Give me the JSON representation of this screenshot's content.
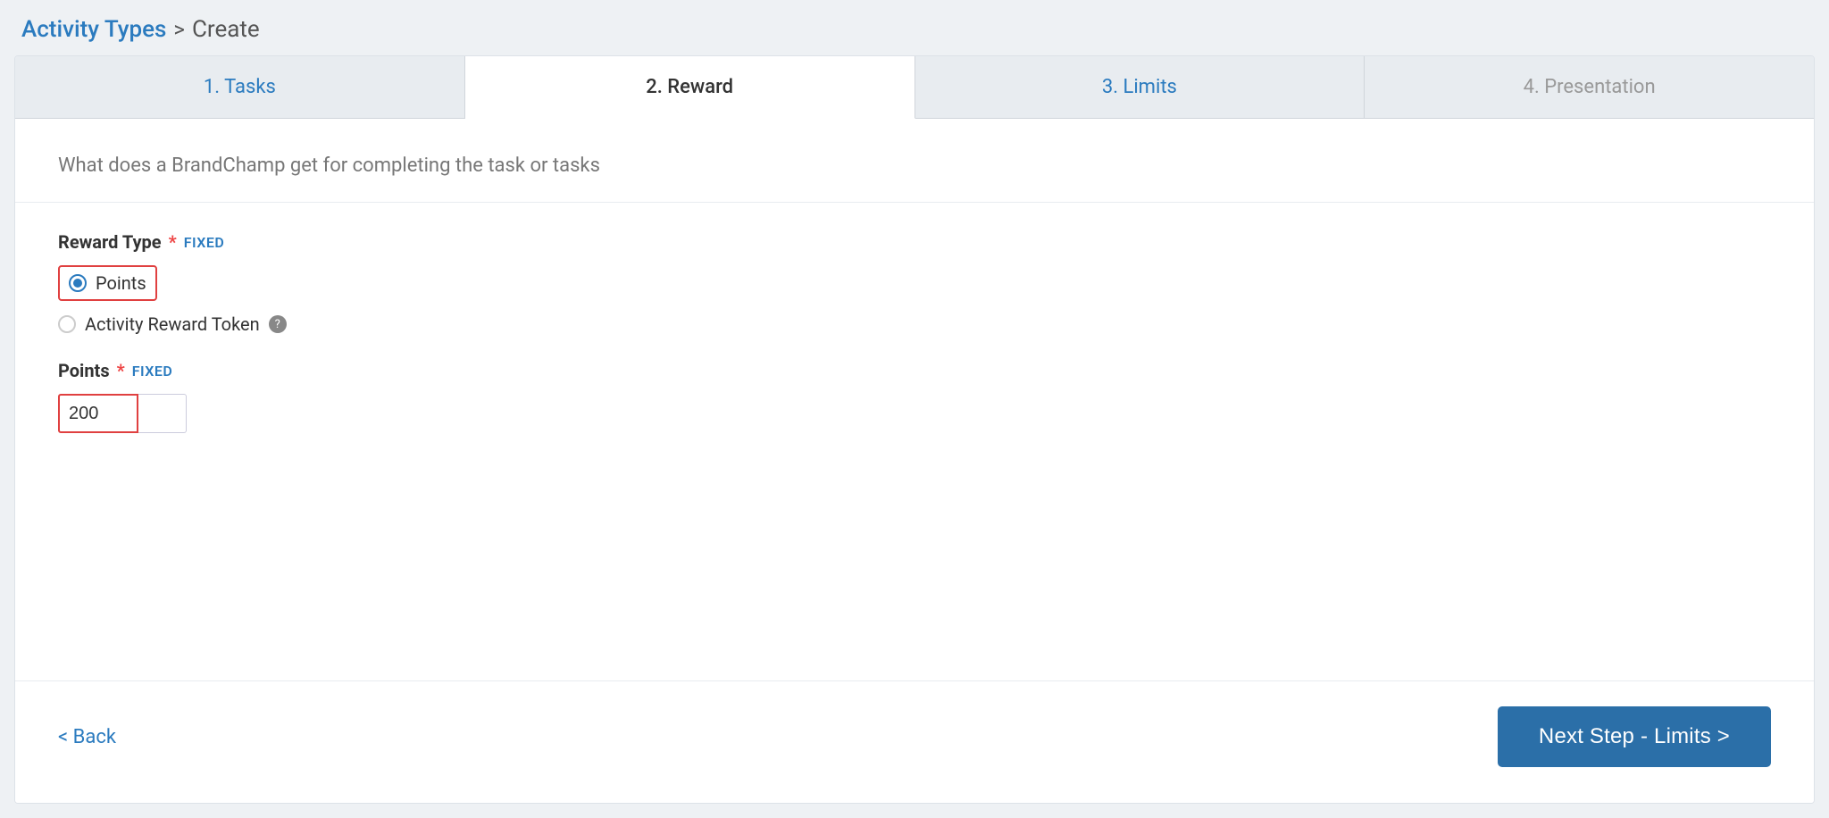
{
  "breadcrumb": {
    "link_label": "Activity Types",
    "separator": ">",
    "current_label": "Create"
  },
  "tabs": [
    {
      "id": "tasks",
      "label": "1. Tasks",
      "state": "inactive"
    },
    {
      "id": "reward",
      "label": "2. Reward",
      "state": "active"
    },
    {
      "id": "limits",
      "label": "3. Limits",
      "state": "inactive"
    },
    {
      "id": "presentation",
      "label": "4. Presentation",
      "state": "inactive-gray"
    }
  ],
  "content": {
    "description": "What does a BrandChamp get for completing the task or tasks",
    "reward_type_label": "Reward Type",
    "required_indicator": "*",
    "fixed_badge": "FIXED",
    "option_points_label": "Points",
    "option_token_label": "Activity Reward Token",
    "points_label": "Points",
    "points_value": "200"
  },
  "actions": {
    "back_label": "< Back",
    "next_label": "Next Step - Limits >"
  }
}
